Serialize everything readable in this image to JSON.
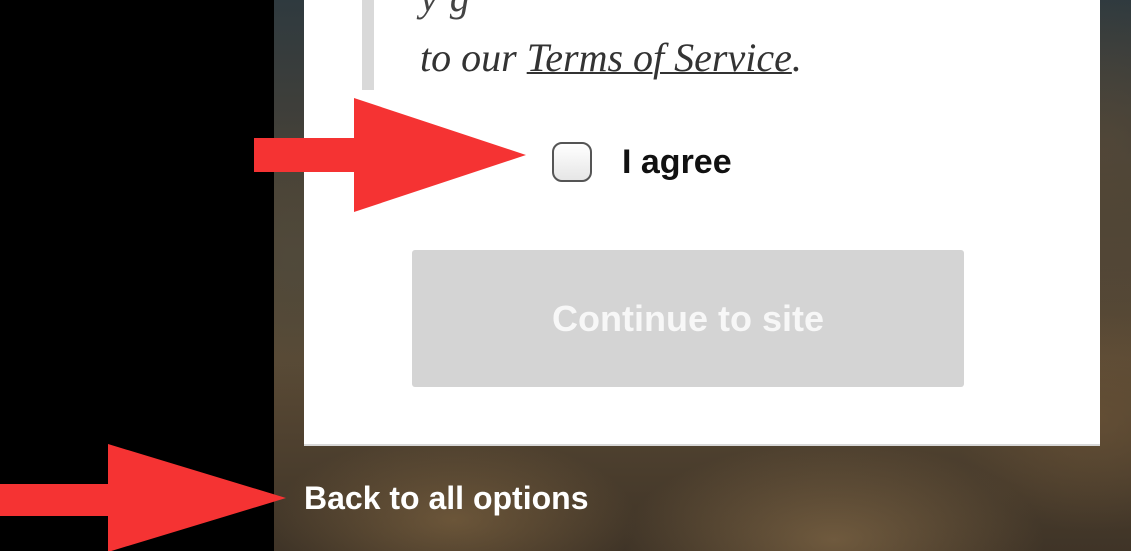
{
  "dialog": {
    "terms_prefix": "to our ",
    "terms_link": "Terms of Service",
    "terms_suffix": ".",
    "agree_label": "I agree",
    "agree_checked": false,
    "continue_button": "Continue to site"
  },
  "footer": {
    "back_link": "Back to all options"
  },
  "colors": {
    "arrow": "#f53333",
    "button_disabled": "#d4d4d4",
    "quote_bar": "#d9d9d9"
  },
  "annotations": {
    "arrow_icon": "right-arrow-icon"
  }
}
